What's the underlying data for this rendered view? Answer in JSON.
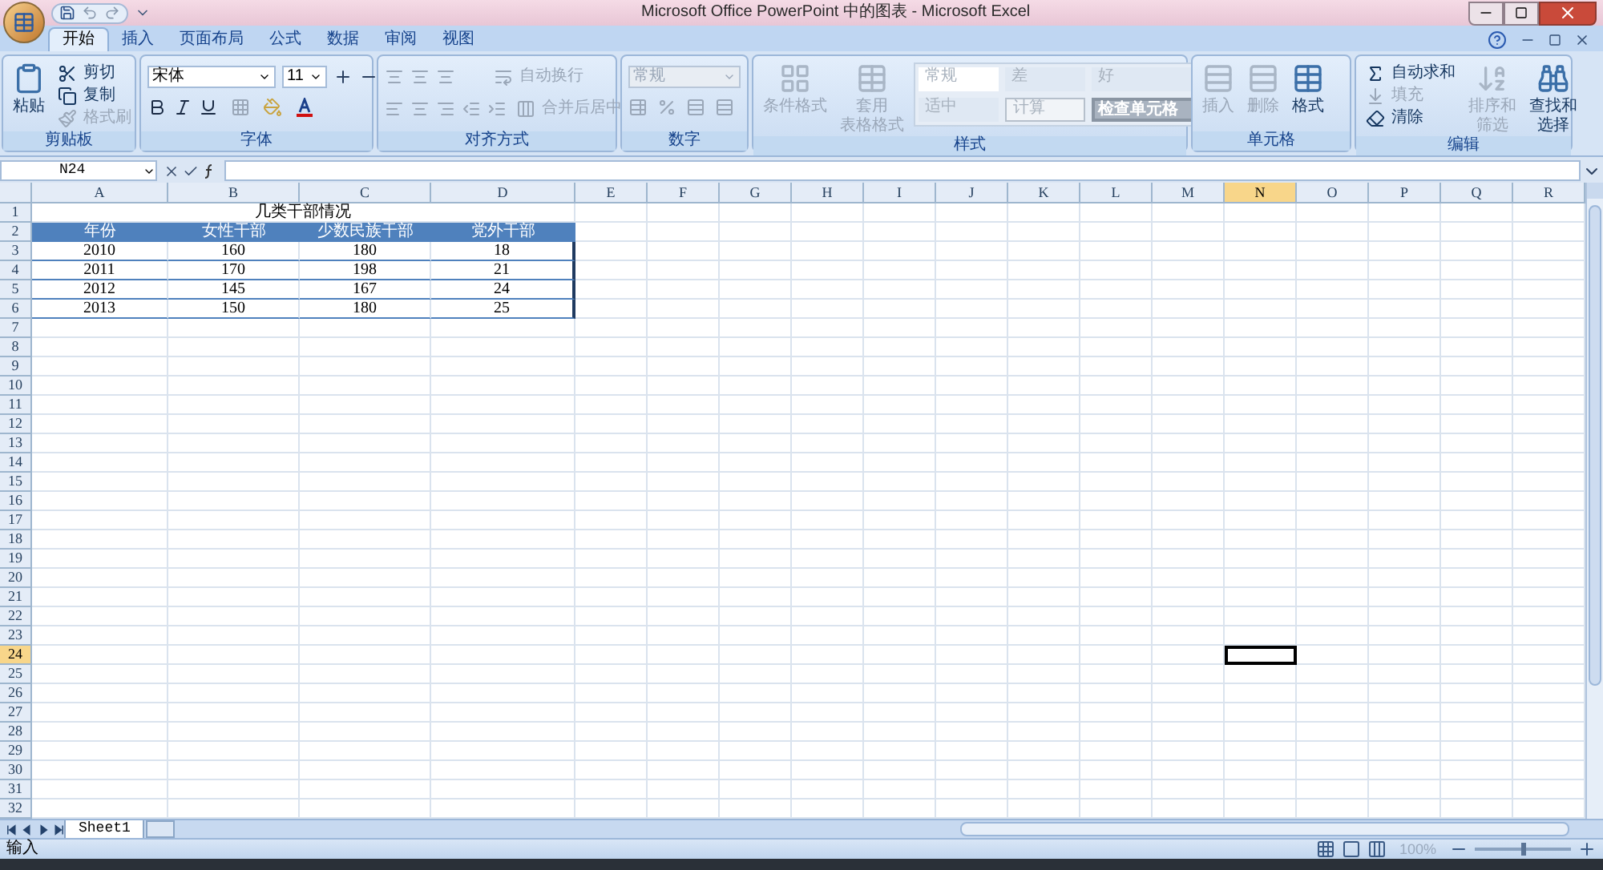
{
  "window": {
    "title": "Microsoft Office PowerPoint 中的图表 - Microsoft Excel"
  },
  "tabs": [
    {
      "label": "开始",
      "selected": true
    },
    {
      "label": "插入",
      "selected": false
    },
    {
      "label": "页面布局",
      "selected": false
    },
    {
      "label": "公式",
      "selected": false
    },
    {
      "label": "数据",
      "selected": false
    },
    {
      "label": "审阅",
      "selected": false
    },
    {
      "label": "视图",
      "selected": false
    }
  ],
  "ribbon": {
    "clipboard": {
      "label": "剪贴板",
      "paste": {
        "label": "粘贴",
        "disabled": false
      },
      "cut": {
        "label": "剪切",
        "disabled": false
      },
      "copy": {
        "label": "复制",
        "disabled": false
      },
      "format_painter": {
        "label": "格式刷",
        "disabled": true
      }
    },
    "font": {
      "label": "字体",
      "font_name": "宋体",
      "font_size": "11"
    },
    "alignment": {
      "label": "对齐方式",
      "wrap_text": {
        "label": "自动换行",
        "disabled": true
      },
      "merge_center": {
        "label": "合并后居中",
        "disabled": true
      }
    },
    "number": {
      "label": "数字",
      "format": {
        "label": "常规",
        "disabled": true
      }
    },
    "styles": {
      "label": "样式",
      "conditional_format": {
        "lines": [
          "条件格式"
        ],
        "disabled": true
      },
      "table_format": {
        "lines": [
          "套用",
          "表格格式"
        ],
        "disabled": true
      },
      "cell_styles": [
        {
          "label": "常规",
          "kind": "normal"
        },
        {
          "label": "差",
          "kind": "bad"
        },
        {
          "label": "好",
          "kind": "good"
        },
        {
          "label": "适中",
          "kind": "neutral"
        },
        {
          "label": "计算",
          "kind": "calculation"
        },
        {
          "label": "检查单元格",
          "kind": "check"
        }
      ]
    },
    "cells": {
      "label": "单元格",
      "insert": {
        "label": "插入",
        "disabled": true
      },
      "delete": {
        "label": "删除",
        "disabled": true
      },
      "format": {
        "label": "格式",
        "disabled": false
      }
    },
    "editing": {
      "label": "编辑",
      "autosum": {
        "label": "自动求和",
        "disabled": false
      },
      "fill": {
        "label": "填充",
        "disabled": true
      },
      "clear": {
        "label": "清除",
        "disabled": false
      },
      "sort_filter": {
        "lines": [
          "排序和",
          "筛选"
        ],
        "disabled": true
      },
      "find_select": {
        "lines": [
          "查找和",
          "选择"
        ],
        "disabled": false
      }
    }
  },
  "name_box": "N24",
  "columns": [
    {
      "label": "A",
      "selected": false
    },
    {
      "label": "B",
      "selected": false
    },
    {
      "label": "C",
      "selected": false
    },
    {
      "label": "D",
      "selected": false
    },
    {
      "label": "E",
      "selected": false
    },
    {
      "label": "F",
      "selected": false
    },
    {
      "label": "G",
      "selected": false
    },
    {
      "label": "H",
      "selected": false
    },
    {
      "label": "I",
      "selected": false
    },
    {
      "label": "J",
      "selected": false
    },
    {
      "label": "K",
      "selected": false
    },
    {
      "label": "L",
      "selected": false
    },
    {
      "label": "M",
      "selected": false
    },
    {
      "label": "N",
      "selected": true
    },
    {
      "label": "O",
      "selected": false
    },
    {
      "label": "P",
      "selected": false
    },
    {
      "label": "Q",
      "selected": false
    },
    {
      "label": "R",
      "selected": false
    }
  ],
  "rows": [
    {
      "label": "1",
      "selected": false
    },
    {
      "label": "2",
      "selected": false
    },
    {
      "label": "3",
      "selected": false
    },
    {
      "label": "4",
      "selected": false
    },
    {
      "label": "5",
      "selected": false
    },
    {
      "label": "6",
      "selected": false
    },
    {
      "label": "7",
      "selected": false
    },
    {
      "label": "8",
      "selected": false
    },
    {
      "label": "9",
      "selected": false
    },
    {
      "label": "10",
      "selected": false
    },
    {
      "label": "11",
      "selected": false
    },
    {
      "label": "12",
      "selected": false
    },
    {
      "label": "13",
      "selected": false
    },
    {
      "label": "14",
      "selected": false
    },
    {
      "label": "15",
      "selected": false
    },
    {
      "label": "16",
      "selected": false
    },
    {
      "label": "17",
      "selected": false
    },
    {
      "label": "18",
      "selected": false
    },
    {
      "label": "19",
      "selected": false
    },
    {
      "label": "20",
      "selected": false
    },
    {
      "label": "21",
      "selected": false
    },
    {
      "label": "22",
      "selected": false
    },
    {
      "label": "23",
      "selected": false
    },
    {
      "label": "24",
      "selected": true
    },
    {
      "label": "25",
      "selected": false
    },
    {
      "label": "26",
      "selected": false
    },
    {
      "label": "27",
      "selected": false
    },
    {
      "label": "28",
      "selected": false
    },
    {
      "label": "29",
      "selected": false
    },
    {
      "label": "30",
      "selected": false
    },
    {
      "label": "31",
      "selected": false
    },
    {
      "label": "32",
      "selected": false
    }
  ],
  "table": {
    "title": "几类干部情况",
    "headers": [
      "年份",
      "女性干部",
      "少数民族干部",
      "党外干部"
    ],
    "rows": [
      [
        "2010",
        "160",
        "180",
        "18"
      ],
      [
        "2011",
        "170",
        "198",
        "21"
      ],
      [
        "2012",
        "145",
        "167",
        "24"
      ],
      [
        "2013",
        "150",
        "180",
        "25"
      ]
    ]
  },
  "sheet_tabs": [
    {
      "label": "Sheet1",
      "selected": true
    }
  ],
  "status_bar": {
    "mode": "输入",
    "zoom": "100%",
    "zoom_slider": {
      "level": 0.5
    }
  }
}
